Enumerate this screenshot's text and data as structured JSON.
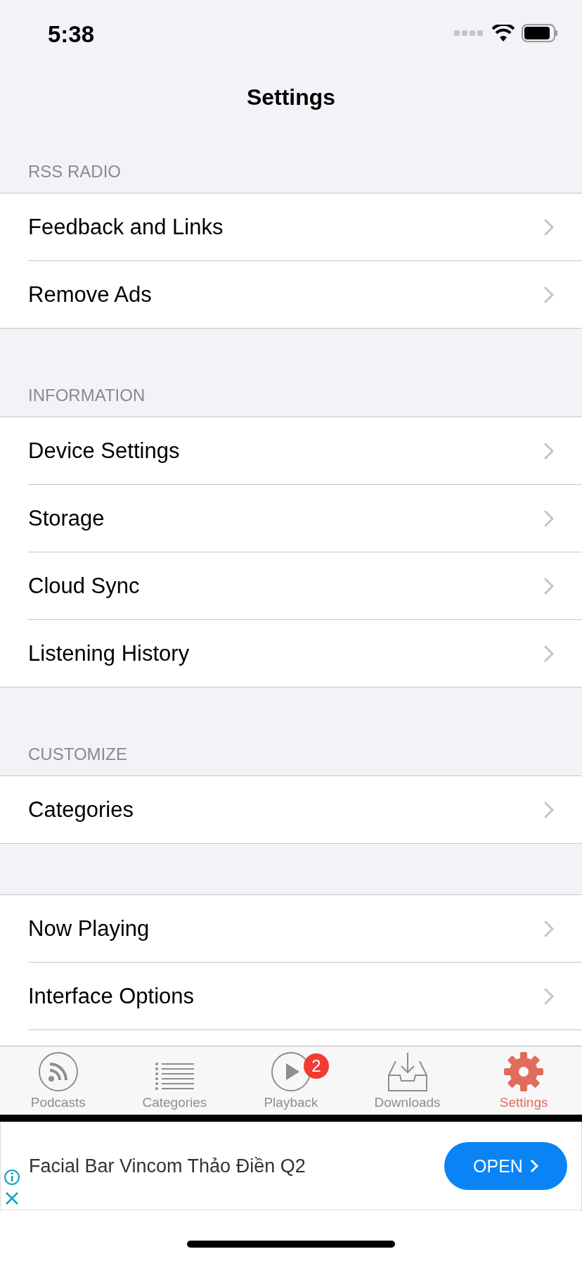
{
  "status_bar": {
    "time": "5:38"
  },
  "nav": {
    "title": "Settings"
  },
  "sections": [
    {
      "header": "RSS RADIO",
      "rows": [
        {
          "label": "Feedback and Links"
        },
        {
          "label": "Remove Ads"
        }
      ]
    },
    {
      "header": "INFORMATION",
      "rows": [
        {
          "label": "Device Settings"
        },
        {
          "label": "Storage"
        },
        {
          "label": "Cloud Sync"
        },
        {
          "label": "Listening History"
        }
      ]
    },
    {
      "header": "CUSTOMIZE",
      "rows": [
        {
          "label": "Categories"
        }
      ]
    },
    {
      "rows": [
        {
          "label": "Now Playing"
        },
        {
          "label": "Interface Options"
        }
      ]
    }
  ],
  "tab_bar": {
    "tabs": [
      {
        "label": "Podcasts",
        "selected": false
      },
      {
        "label": "Categories",
        "selected": false
      },
      {
        "label": "Playback",
        "selected": false,
        "badge": "2"
      },
      {
        "label": "Downloads",
        "selected": false
      },
      {
        "label": "Settings",
        "selected": true
      }
    ]
  },
  "ad": {
    "text": "Facial Bar Vincom Thảo Điền Q2",
    "button": "OPEN"
  }
}
